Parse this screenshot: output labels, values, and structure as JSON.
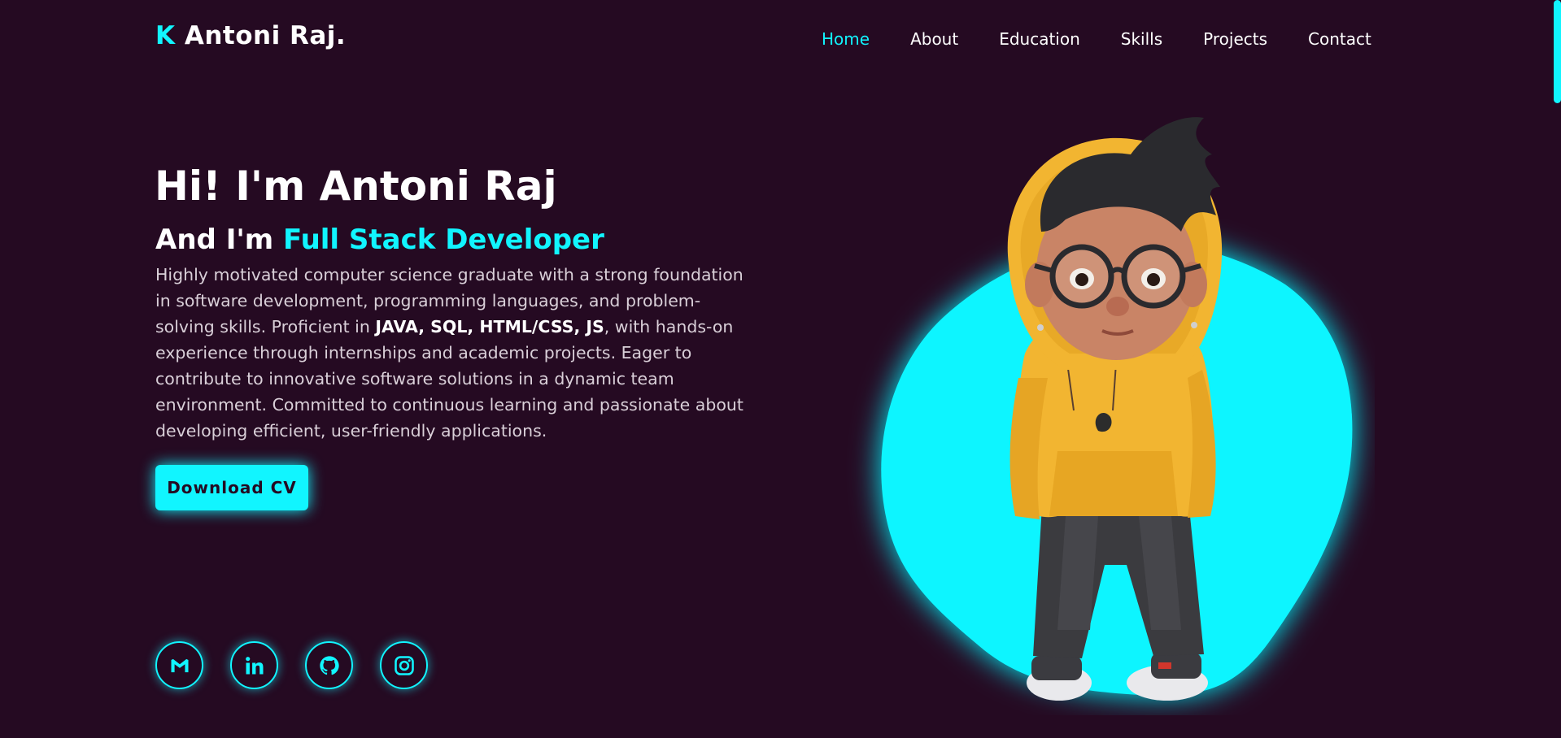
{
  "header": {
    "logo_initial": "K",
    "logo_name": "Antoni Raj."
  },
  "nav": {
    "items": [
      "Home",
      "About",
      "Education",
      "Skills",
      "Projects",
      "Contact"
    ],
    "active": "Home"
  },
  "hero": {
    "greeting": "Hi! I'm Antoni Raj",
    "subtitle_prefix": "And I'm",
    "role": "Full Stack Developer",
    "desc_part1": "Highly motivated computer science graduate with a strong foundation in software development, programming languages, and problem-solving skills. Proficient in ",
    "desc_skills": "JAVA, SQL, HTML/CSS, JS",
    "desc_part2": ", with hands-on experience through internships and academic projects. Eager to contribute to innovative software solutions in a dynamic team environment. Committed to continuous learning and passionate about developing efficient, user-friendly applications.",
    "cta_label": "Download CV"
  },
  "socials": {
    "icons": [
      "gmail-icon",
      "linkedin-icon",
      "github-icon",
      "instagram-icon"
    ]
  },
  "colors": {
    "background": "#250a22",
    "accent": "#11f5ff",
    "text": "#ffffff",
    "muted_text": "#d9cfd8",
    "hoodie": "#f2b531",
    "pants": "#3a3a3c"
  }
}
